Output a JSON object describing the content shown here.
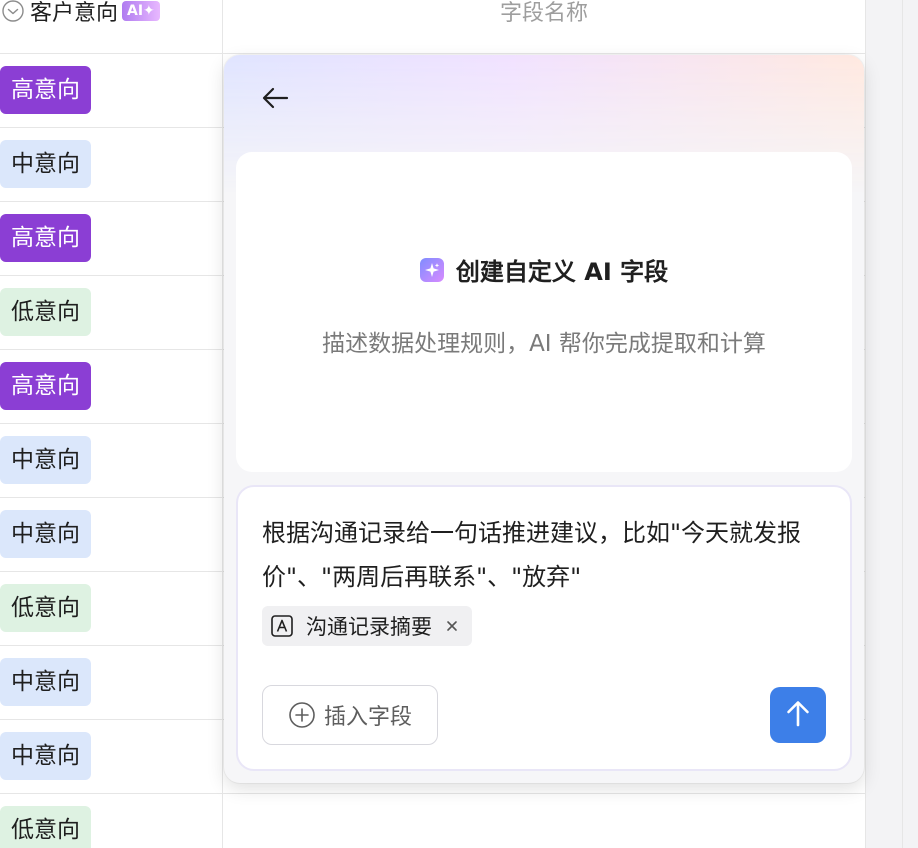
{
  "table": {
    "header": {
      "column1": {
        "title": "客户意向",
        "ai_badge": "AI✦",
        "dropdown_icon": "chevron-down-circle-icon"
      },
      "column2": {
        "title": "字段名称"
      }
    },
    "rows": [
      {
        "tag": "高意向",
        "level": "high"
      },
      {
        "tag": "中意向",
        "level": "mid"
      },
      {
        "tag": "高意向",
        "level": "high"
      },
      {
        "tag": "低意向",
        "level": "low"
      },
      {
        "tag": "高意向",
        "level": "high"
      },
      {
        "tag": "中意向",
        "level": "mid"
      },
      {
        "tag": "中意向",
        "level": "mid"
      },
      {
        "tag": "低意向",
        "level": "low"
      },
      {
        "tag": "中意向",
        "level": "mid"
      },
      {
        "tag": "中意向",
        "level": "mid"
      },
      {
        "tag": "低意向",
        "level": "low"
      }
    ]
  },
  "panel": {
    "back_icon": "arrow-left-icon",
    "intro": {
      "icon": "sparkle-icon",
      "title": "创建自定义 AI 字段",
      "subtitle": "描述数据处理规则，AI 帮你完成提取和计算"
    },
    "input": {
      "prompt_text": "根据沟通记录给一句话推进建议，比如\"今天就发报价\"、\"两周后再联系\"、\"放弃\"",
      "chip": {
        "icon": "text-field-icon",
        "label": "沟通记录摘要",
        "close_icon": "close-icon"
      },
      "insert_field_label": "插入字段",
      "insert_field_icon": "plus-circle-icon",
      "send_icon": "arrow-up-icon"
    }
  },
  "colors": {
    "high_tag_bg": "#8b3ed4",
    "mid_tag_bg": "#dbe7fb",
    "low_tag_bg": "#def2e2",
    "send_button_bg": "#3d7fe8",
    "ai_badge_gradient_start": "#b07cf0"
  }
}
